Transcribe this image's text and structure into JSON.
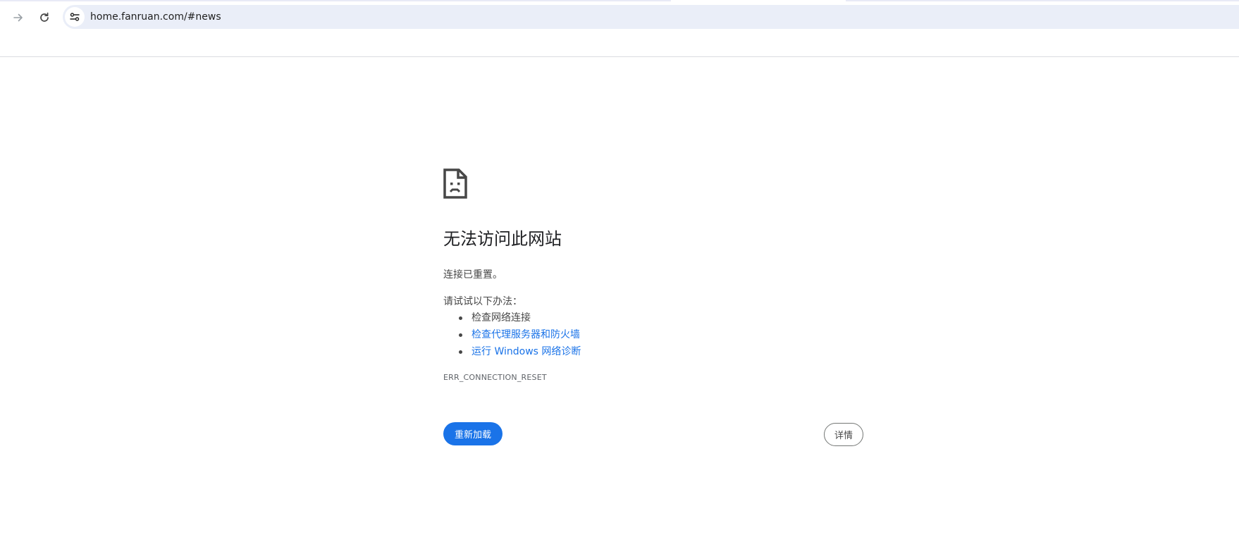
{
  "browser": {
    "url": "home.fanruan.com/#news",
    "icons": {
      "forward": "arrow-right-icon",
      "reload": "reload-icon",
      "site_info": "tune-icon"
    }
  },
  "error_page": {
    "icon": "sad-document-icon",
    "title": "无法访问此网站",
    "subtitle": "连接已重置。",
    "try_label": "请试试以下办法：",
    "suggestions": [
      {
        "text": "检查网络连接",
        "is_link": false
      },
      {
        "text": "检查代理服务器和防火墙",
        "is_link": true
      },
      {
        "text": "运行 Windows 网络诊断",
        "is_link": true
      }
    ],
    "error_code": "ERR_CONNECTION_RESET",
    "reload_label": "重新加载",
    "details_label": "详情"
  },
  "colors": {
    "primary": "#1a73e8",
    "link": "#1a73e8",
    "omnibox_bg": "#eaeef8",
    "text": "#474747"
  }
}
